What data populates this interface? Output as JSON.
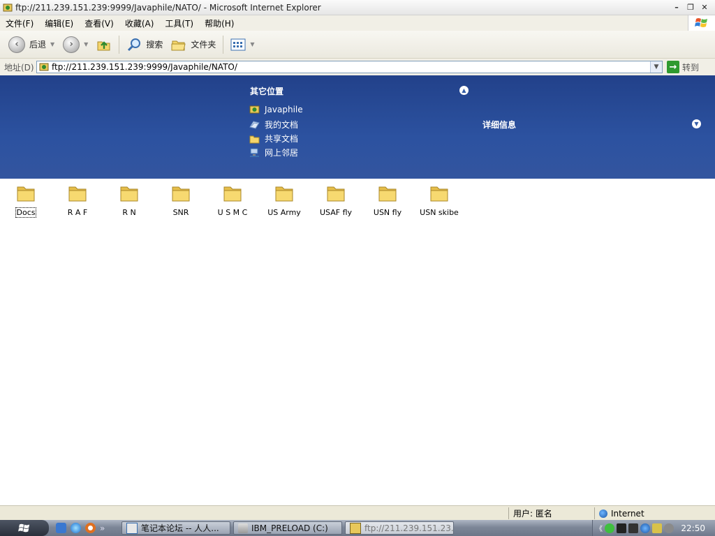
{
  "window": {
    "title": "ftp://211.239.151.239:9999/Javaphile/NATO/ - Microsoft Internet Explorer",
    "minimize_glyph": "–",
    "restore_glyph": "❐",
    "close_glyph": "✕"
  },
  "menubar": {
    "items": [
      {
        "label": "文件(F)"
      },
      {
        "label": "编辑(E)"
      },
      {
        "label": "查看(V)"
      },
      {
        "label": "收藏(A)"
      },
      {
        "label": "工具(T)"
      },
      {
        "label": "帮助(H)"
      }
    ]
  },
  "toolbar": {
    "back_label": "后退",
    "search_label": "搜索",
    "folders_label": "文件夹"
  },
  "address": {
    "label": "地址(D)",
    "value": "ftp://211.239.151.239:9999/Javaphile/NATO/",
    "go_label": "转到"
  },
  "other_places": {
    "title": "其它位置",
    "links": [
      {
        "label": "Javaphile",
        "icon": "ftp-folder-icon"
      },
      {
        "label": "我的文档",
        "icon": "my-documents-icon"
      },
      {
        "label": "共享文档",
        "icon": "shared-folder-icon"
      },
      {
        "label": "网上邻居",
        "icon": "network-places-icon"
      }
    ]
  },
  "details": {
    "title": "详细信息"
  },
  "files": [
    {
      "name": "Docs"
    },
    {
      "name": "R A F"
    },
    {
      "name": "R N"
    },
    {
      "name": "SNR"
    },
    {
      "name": "U S M C"
    },
    {
      "name": "US Army"
    },
    {
      "name": "USAF fly"
    },
    {
      "name": "USN fly"
    },
    {
      "name": "USN skibe"
    }
  ],
  "statusbar": {
    "user": "用户: 匿名",
    "zone": "Internet"
  },
  "taskbar": {
    "tasks": [
      {
        "label": "笔记本论坛 -- 人人...",
        "active": false
      },
      {
        "label": "IBM_PRELOAD (C:)",
        "active": false
      },
      {
        "label": "ftp://211.239.151.23...",
        "active": true
      }
    ],
    "quicklaunch_more": "»",
    "tray_expand": "《",
    "clock": "22:50"
  },
  "colors": {
    "panel_blue": "#2c52a0",
    "folder_yellow": "#f5d56b"
  }
}
